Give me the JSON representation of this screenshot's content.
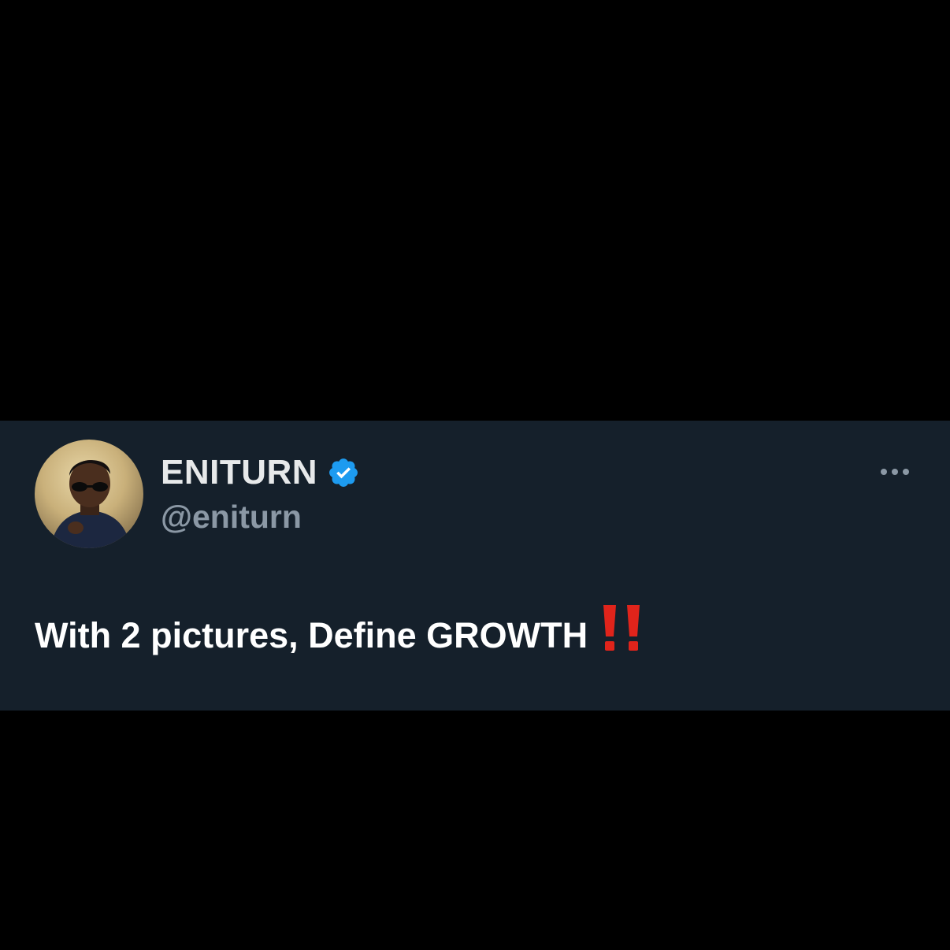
{
  "tweet": {
    "author": {
      "display_name": "ENITURN",
      "handle": "@eniturn",
      "verified": true,
      "verified_badge_icon": "verified-badge-icon",
      "avatar_icon": "profile-photo"
    },
    "text": "With 2 pictures, Define GROWTH",
    "trailing_emoji": "double-exclamation-mark-icon",
    "more_options_icon": "more-horizontal-icon"
  },
  "colors": {
    "page_background": "#000000",
    "card_background": "#15202b",
    "display_name": "#e7e9ea",
    "handle": "#8b98a5",
    "tweet_text": "#ffffff",
    "verified_blue": "#1d9bf0",
    "emoji_red": "#e0241b"
  }
}
